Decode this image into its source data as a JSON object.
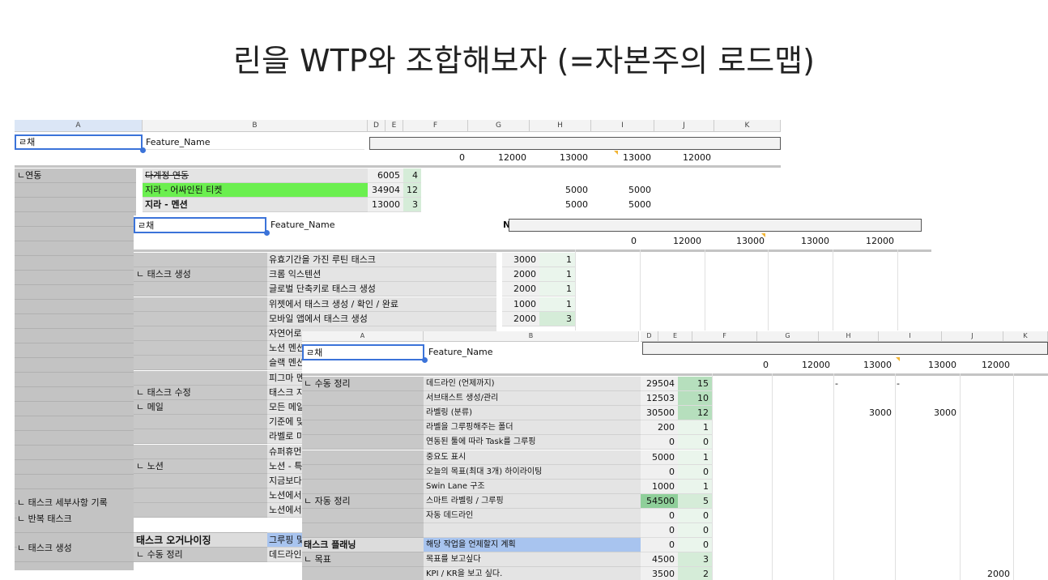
{
  "slide_title": "린을 WTP와 조합해보자 (=자본주의 로드맵)",
  "sheet1": {
    "col_headers": [
      "A",
      "B",
      "D",
      "E",
      "F",
      "G",
      "H",
      "I",
      "J",
      "K"
    ],
    "a_value": "ㄹ채",
    "b_value": "Feature_Name",
    "totals": [
      "0",
      "12000",
      "13000",
      "13000",
      "12000"
    ],
    "rows": [
      {
        "a": "ㄴ연동",
        "b": "다계정 연동",
        "d": "6005",
        "e": "4",
        "h": "",
        "i": ""
      },
      {
        "a": "",
        "b": "지라 - 어싸인된 티켓",
        "d": "34904",
        "e": "12",
        "h": "5000",
        "i": "5000"
      },
      {
        "a": "",
        "b": "지라 - 멘션",
        "d": "13000",
        "e": "3",
        "h": "5000",
        "i": "5000"
      }
    ],
    "left_groups": [
      {
        "label": "ㄴ 태스크 세부사항 기록"
      },
      {
        "label": "ㄴ 반복 태스크"
      },
      {
        "label": "ㄴ 태스크 생성"
      }
    ]
  },
  "sheet2": {
    "a_value": "ㄹ채",
    "b_value": "Feature_Name",
    "c_header_fragment": "N",
    "totals": [
      "0",
      "12000",
      "13000",
      "13000",
      "12000"
    ],
    "rows": [
      {
        "a": "",
        "b": "유효기간을 가진 루틴 태스크",
        "d": "3000",
        "e": "1"
      },
      {
        "a": "ㄴ 태스크 생성",
        "b": "크롬 익스텐션",
        "d": "2000",
        "e": "1"
      },
      {
        "a": "",
        "b": "글로벌 단축키로 태스크 생성",
        "d": "2000",
        "e": "1"
      },
      {
        "a": "",
        "b": "위젯에서 태스크 생성 / 확인 / 완료",
        "d": "1000",
        "e": "1"
      },
      {
        "a": "",
        "b": "모바일 앱에서 태스크 생성",
        "d": "2000",
        "e": "3"
      },
      {
        "a": "",
        "b": "자연어로"
      },
      {
        "a": "",
        "b": "노션 멘션"
      },
      {
        "a": "",
        "b": "슬랙 멘션"
      },
      {
        "a": "",
        "b": "피그마 멘"
      },
      {
        "a": "ㄴ 태스크 수정",
        "b": "태스크 지"
      },
      {
        "a": "ㄴ 메일",
        "b": "모든 메일"
      },
      {
        "a": "",
        "b": "기준에 맞"
      },
      {
        "a": "",
        "b": "라벨로 미"
      },
      {
        "a": "",
        "b": "슈퍼휴먼"
      },
      {
        "a": "ㄴ 노션",
        "b": "노션 - 특"
      },
      {
        "a": "",
        "b": "지금보다"
      },
      {
        "a": "",
        "b": "노션에서"
      },
      {
        "a": "",
        "b": "노션에서"
      },
      {
        "a": "",
        "b": ""
      },
      {
        "a": "태스크 오거나이징",
        "b": "그루핑 및"
      },
      {
        "a": "ㄴ 수동 정리",
        "b": "데드라인"
      }
    ]
  },
  "sheet3": {
    "col_headers": [
      "A",
      "B",
      "D",
      "E",
      "F",
      "G",
      "H",
      "I",
      "J",
      "K"
    ],
    "a_value": "ㄹ채",
    "b_value": "Feature_Name",
    "totals": [
      "0",
      "12000",
      "13000",
      "13000",
      "12000"
    ],
    "rows": [
      {
        "a": "ㄴ 수동 정리",
        "b": "데드라인 (언제까지)",
        "d": "29504",
        "e": "15",
        "g": "",
        "h": "-",
        "i": "-",
        "j": ""
      },
      {
        "a": "",
        "b": "서브태스트 생성/관리",
        "d": "12503",
        "e": "10"
      },
      {
        "a": "",
        "b": "라벨링 (분류)",
        "d": "30500",
        "e": "12",
        "h": "3000",
        "i": "3000"
      },
      {
        "a": "",
        "b": "라벨을 그루핑해주는 폴더",
        "d": "200",
        "e": "1"
      },
      {
        "a": "",
        "b": "연동된 툴에 따라 Task를 그루핑",
        "d": "0",
        "e": "0"
      },
      {
        "a": "",
        "b": "중요도 표시",
        "d": "5000",
        "e": "1"
      },
      {
        "a": "",
        "b": "오늘의 목표(최대 3개) 하이라이팅",
        "d": "0",
        "e": "0"
      },
      {
        "a": "",
        "b": "Swin Lane 구조",
        "d": "1000",
        "e": "1"
      },
      {
        "a": "ㄴ 자동 정리",
        "b": "스마트 라벨링 / 그루핑",
        "d": "54500",
        "e": "5"
      },
      {
        "a": "",
        "b": "자동 데드라인",
        "d": "0",
        "e": "0"
      },
      {
        "a": "",
        "b": "",
        "d": "0",
        "e": "0"
      },
      {
        "a": "태스크 플래닝",
        "b": "해당 작업을 언제할지 계획",
        "d": "0",
        "e": "0"
      },
      {
        "a": "ㄴ 목표",
        "b": "목표를 보고싶다",
        "d": "4500",
        "e": "3"
      },
      {
        "a": "",
        "b": "KPI / KR을 보고 싶다.",
        "d": "3500",
        "e": "2",
        "j": "2000"
      }
    ]
  }
}
